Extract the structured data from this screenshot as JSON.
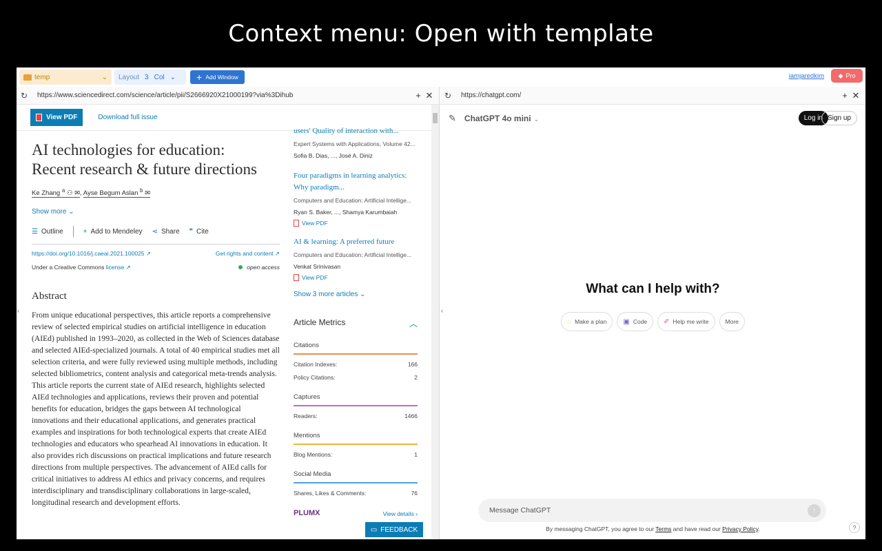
{
  "caption": "Context menu: Open with template",
  "topbar": {
    "folder": "temp",
    "layout_label": "Layout",
    "layout_num": "3",
    "layout_unit": "Col",
    "add_window": "Add Window",
    "user": "iamjaredkim",
    "pro": "Pro"
  },
  "left": {
    "url": "https://www.sciencedirect.com/science/article/pii/S2666920X21000199?via%3Dihub",
    "view_pdf": "View PDF",
    "download_issue": "Download full issue",
    "title_l1": "AI technologies for education:",
    "title_l2": "Recent research & future directions",
    "author1": "Ke Zhang",
    "author1_sup": "a",
    "author2": "Ayse Begum Aslan",
    "author2_sup": "b",
    "show_more": "Show more",
    "tools": {
      "outline": "Outline",
      "mendeley": "Add to Mendeley",
      "share": "Share",
      "cite": "Cite"
    },
    "doi": "https://doi.org/10.1016/j.caeai.2021.100025",
    "rights": "Get rights and content",
    "cc_prefix": "Under a Creative Commons",
    "cc_link": "license",
    "open_access": "open access",
    "abstract_heading": "Abstract",
    "abstract_text": "From unique educational perspectives, this article reports a comprehensive review of selected empirical studies on artificial intelligence in education (AIEd) published in 1993–2020, as collected in the Web of Sciences database and selected AIEd-specialized journals. A total of 40 empirical studies met all selection criteria, and were fully reviewed using multiple methods, including selected bibliometrics, content analysis and categorical meta-trends analysis. This article reports the current state of AIEd research, highlights selected AIEd technologies and applications, reviews their proven and potential benefits for education, bridges the gaps between AI technological innovations and their educational applications, and generates practical examples and inspirations for both technological experts that create AIEd technologies and educators who spearhead AI innovations in education. It also provides rich discussions on practical implications and future research directions from multiple perspectives. The advancement of AIEd calls for critical initiatives to address AI ethics and privacy concerns, and requires interdisciplinary and transdisciplinary collaborations in large-scaled, longitudinal research and development efforts.",
    "side": {
      "top_link": "users' Quality of interaction with...",
      "top_meta": "Expert Systems with Applications, Volume 42...",
      "top_auth": "Sofia B. Dias, ..., José A. Diniz",
      "a2_title": "Four paradigms in learning analytics: Why paradigm...",
      "a2_meta": "Computers and Education: Artificial Intellige...",
      "a2_auth": "Ryan S. Baker, ..., Shamya Karumbaiah",
      "a2_pdf": "View PDF",
      "a3_title": "AI & learning: A preferred future",
      "a3_meta": "Computers and Education: Artificial Intellige...",
      "a3_auth": "Venkat Srinivasan",
      "a3_pdf": "View PDF",
      "show3": "Show 3 more articles",
      "metrics_heading": "Article Metrics",
      "cat1": "Citations",
      "r1_label": "Citation Indexes:",
      "r1_val": "166",
      "r2_label": "Policy Citations:",
      "r2_val": "2",
      "cat2": "Captures",
      "r3_label": "Readers:",
      "r3_val": "1466",
      "cat3": "Mentions",
      "r4_label": "Blog Mentions:",
      "r4_val": "1",
      "cat4": "Social Media",
      "r5_label": "Shares, Likes & Comments:",
      "r5_val": "76",
      "plumx": "PLUMX",
      "view_details": "View details"
    },
    "feedback": "FEEDBACK"
  },
  "right": {
    "url": "https://chatgpt.com/",
    "model": "ChatGPT 4o mini",
    "login": "Log in",
    "signup": "Sign up",
    "hero": "What can I help with?",
    "chips": [
      "Make a plan",
      "Code",
      "Help me write",
      "More"
    ],
    "input_placeholder": "Message ChatGPT",
    "disc_1": "By messaging ChatGPT, you agree to our",
    "disc_terms": "Terms",
    "disc_2": "and have read our",
    "disc_privacy": "Privacy Policy",
    "disc_3": ".",
    "help": "?"
  },
  "colors": {
    "accent": "#2f74d0",
    "sd_blue": "#0c7db4",
    "pro": "#f26a6a",
    "citations": "#f08a4b",
    "captures": "#b86ad8",
    "mentions": "#f1b43c",
    "social": "#4fa3e0"
  }
}
